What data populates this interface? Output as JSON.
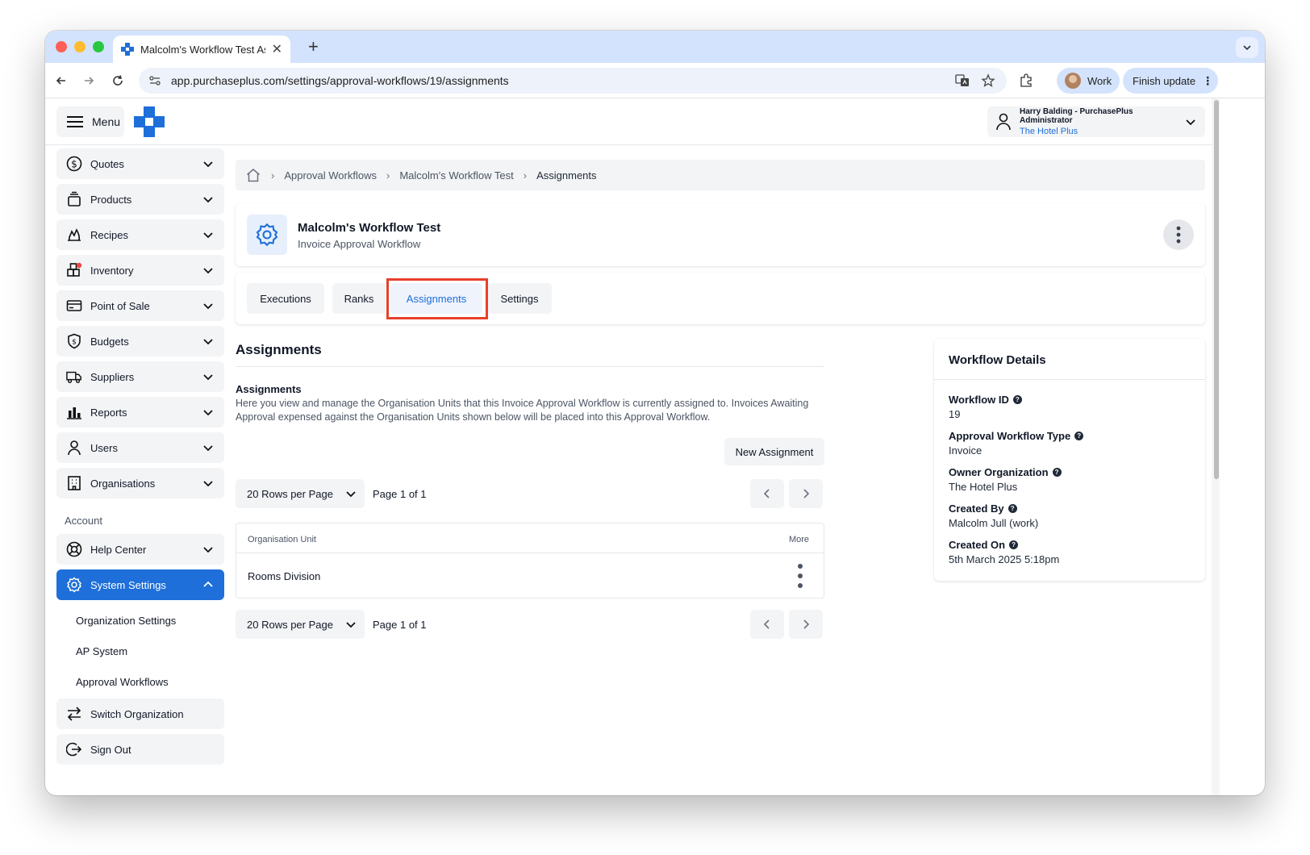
{
  "browser": {
    "tab_title": "Malcolm's Workflow Test Ass",
    "url": "app.purchaseplus.com/settings/approval-workflows/19/assignments",
    "profile_label": "Work",
    "update_label": "Finish update"
  },
  "header": {
    "menu_label": "Menu",
    "user_name": "Harry Balding - PurchasePlus Administrator",
    "user_org": "The Hotel Plus"
  },
  "sidebar": {
    "items": [
      {
        "label": "Quotes",
        "icon": "dollar-icon"
      },
      {
        "label": "Products",
        "icon": "box-icon"
      },
      {
        "label": "Recipes",
        "icon": "flame-icon"
      },
      {
        "label": "Inventory",
        "icon": "inventory-icon"
      },
      {
        "label": "Point of Sale",
        "icon": "card-icon"
      },
      {
        "label": "Budgets",
        "icon": "shield-dollar-icon"
      },
      {
        "label": "Suppliers",
        "icon": "truck-icon"
      },
      {
        "label": "Reports",
        "icon": "bar-chart-icon"
      },
      {
        "label": "Users",
        "icon": "user-icon"
      },
      {
        "label": "Organisations",
        "icon": "building-icon"
      }
    ],
    "account_heading": "Account",
    "help_center": "Help Center",
    "system_settings": "System Settings",
    "sub_items": [
      "Organization Settings",
      "AP System",
      "Approval Workflows"
    ],
    "switch_org": "Switch Organization",
    "sign_out": "Sign Out"
  },
  "breadcrumb": {
    "items": [
      "Approval Workflows",
      "Malcolm's Workflow Test"
    ],
    "current": "Assignments"
  },
  "workflow": {
    "title": "Malcolm's Workflow Test",
    "subtitle": "Invoice Approval Workflow"
  },
  "tabs": [
    "Executions",
    "Ranks",
    "Assignments",
    "Settings"
  ],
  "assignments": {
    "heading": "Assignments",
    "desc_title": "Assignments",
    "desc_text": "Here you view and manage the Organisation Units that this Invoice Approval Workflow is currently assigned to. Invoices Awaiting Approval expensed against the Organisation Units shown below will be placed into this Approval Workflow.",
    "new_button": "New Assignment",
    "rows_per_page": "20 Rows per Page",
    "page_info": "Page 1 of 1",
    "table": {
      "col_unit": "Organisation Unit",
      "col_more": "More",
      "rows": [
        "Rooms Division"
      ]
    }
  },
  "details": {
    "title": "Workflow Details",
    "fields": [
      {
        "label": "Workflow ID",
        "value": "19"
      },
      {
        "label": "Approval Workflow Type",
        "value": "Invoice"
      },
      {
        "label": "Owner Organization",
        "value": "The Hotel Plus"
      },
      {
        "label": "Created By",
        "value": "Malcolm Jull (work)"
      },
      {
        "label": "Created On",
        "value": "5th March 2025 5:18pm"
      }
    ]
  },
  "colors": {
    "accent": "#1e6fd9",
    "highlight": "#e8402a"
  }
}
